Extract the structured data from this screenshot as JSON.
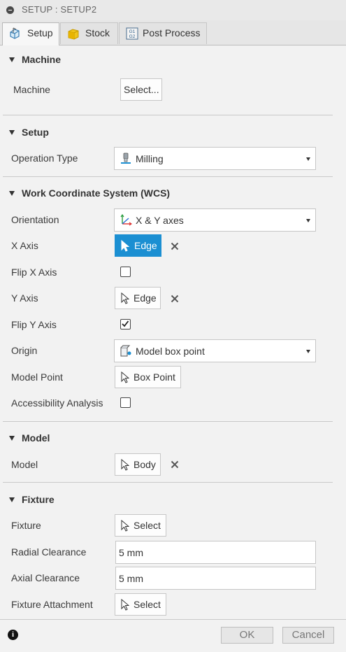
{
  "window": {
    "title": "SETUP : SETUP2"
  },
  "tabs": [
    {
      "label": "Setup",
      "icon": "setup-icon",
      "active": true
    },
    {
      "label": "Stock",
      "icon": "stock-cube-icon",
      "active": false
    },
    {
      "label": "Post Process",
      "icon": "gcode-icon",
      "active": false
    }
  ],
  "machine": {
    "header": "Machine",
    "label": "Machine",
    "button": "Select..."
  },
  "setup": {
    "header": "Setup",
    "operation_type_label": "Operation Type",
    "operation_type_value": "Milling"
  },
  "wcs": {
    "header": "Work Coordinate System (WCS)",
    "orientation_label": "Orientation",
    "orientation_value": "X & Y axes",
    "x_axis_label": "X Axis",
    "x_axis_button": "Edge",
    "flip_x_label": "Flip X Axis",
    "flip_x_checked": false,
    "y_axis_label": "Y Axis",
    "y_axis_button": "Edge",
    "flip_y_label": "Flip Y Axis",
    "flip_y_checked": true,
    "origin_label": "Origin",
    "origin_value": "Model box point",
    "model_point_label": "Model Point",
    "model_point_button": "Box Point",
    "accessibility_label": "Accessibility Analysis",
    "accessibility_checked": false
  },
  "model": {
    "header": "Model",
    "label": "Model",
    "button": "Body"
  },
  "fixture": {
    "header": "Fixture",
    "fixture_label": "Fixture",
    "fixture_button": "Select",
    "radial_label": "Radial Clearance",
    "radial_value": "5 mm",
    "axial_label": "Axial Clearance",
    "axial_value": "5 mm",
    "attachment_label": "Fixture Attachment",
    "attachment_button": "Select"
  },
  "footer": {
    "info_icon": "info-icon",
    "ok_label": "OK",
    "cancel_label": "Cancel"
  },
  "colors": {
    "accent": "#1b8fd2",
    "background": "#f2f2f2"
  }
}
